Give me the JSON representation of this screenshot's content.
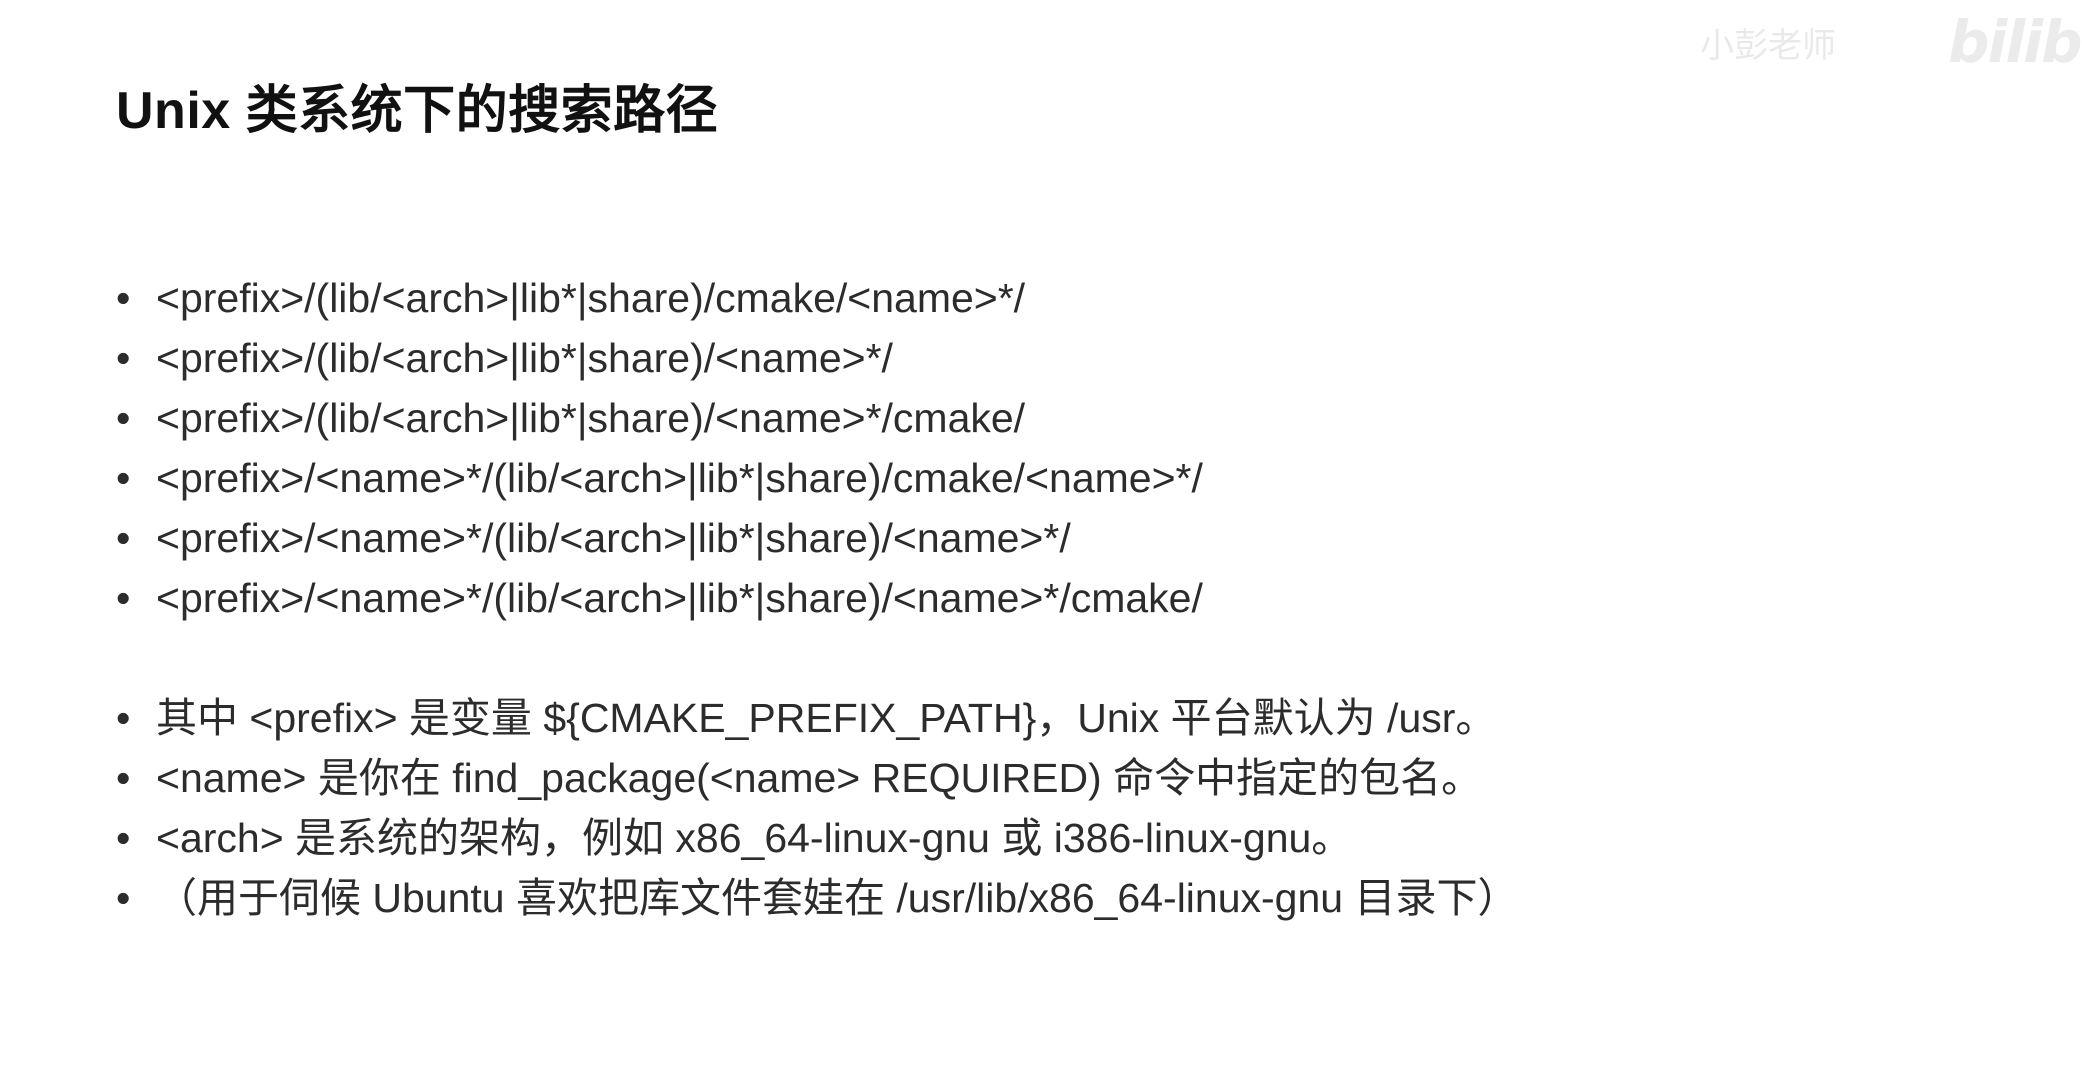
{
  "title": "Unix 类系统下的搜索路径",
  "bullet_symbol": "•",
  "search_paths": [
    "<prefix>/(lib/<arch>|lib*|share)/cmake/<name>*/",
    "<prefix>/(lib/<arch>|lib*|share)/<name>*/",
    "<prefix>/(lib/<arch>|lib*|share)/<name>*/cmake/",
    "<prefix>/<name>*/(lib/<arch>|lib*|share)/cmake/<name>*/",
    "<prefix>/<name>*/(lib/<arch>|lib*|share)/<name>*/",
    "<prefix>/<name>*/(lib/<arch>|lib*|share)/<name>*/cmake/"
  ],
  "notes": [
    "其中 <prefix> 是变量 ${CMAKE_PREFIX_PATH}，Unix 平台默认为 /usr。",
    "<name> 是你在 find_package(<name> REQUIRED) 命令中指定的包名。",
    "<arch> 是系统的架构，例如 x86_64-linux-gnu 或 i386-linux-gnu。",
    "（用于伺候 Ubuntu 喜欢把库文件套娃在 /usr/lib/x86_64-linux-gnu 目录下）"
  ],
  "watermark": {
    "text": "小彭老师",
    "logo": "bilibili"
  }
}
